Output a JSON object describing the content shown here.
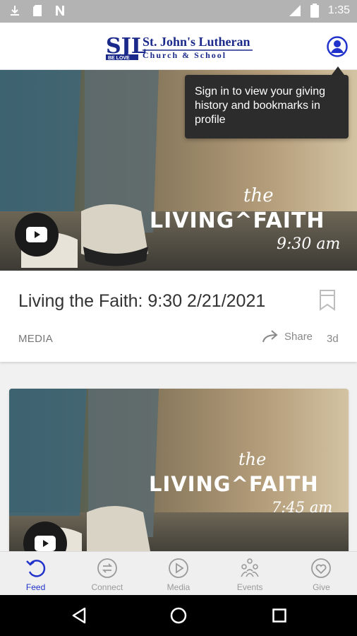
{
  "status_bar": {
    "time": "1:35"
  },
  "header": {
    "logo_monogram": "SJL",
    "logo_tagline": "BE LOVE",
    "logo_line1": "St. John's Lutheran",
    "logo_line2": "Church & School"
  },
  "tooltip": {
    "text": "Sign in to view your giving history and bookmarks in profile"
  },
  "feed": {
    "items": [
      {
        "image_text_small": "the",
        "image_text_main": "LIVING^FAITH",
        "image_time": "9:30 am",
        "title": "Living the Faith: 9:30 2/21/2021",
        "category": "MEDIA",
        "share_label": "Share",
        "age": "3d"
      },
      {
        "image_text_small": "the",
        "image_text_main": "LIVING^FAITH",
        "image_time": "7:45 am"
      }
    ]
  },
  "bottom_nav": {
    "items": [
      {
        "label": "Feed",
        "icon": "feed-icon",
        "active": true
      },
      {
        "label": "Connect",
        "icon": "connect-icon",
        "active": false
      },
      {
        "label": "Media",
        "icon": "media-icon",
        "active": false
      },
      {
        "label": "Events",
        "icon": "events-icon",
        "active": false
      },
      {
        "label": "Give",
        "icon": "give-icon",
        "active": false
      }
    ]
  },
  "colors": {
    "accent": "#2233cc",
    "tooltip_bg": "#2c2c2c",
    "logo_navy": "#1b2a8a"
  }
}
